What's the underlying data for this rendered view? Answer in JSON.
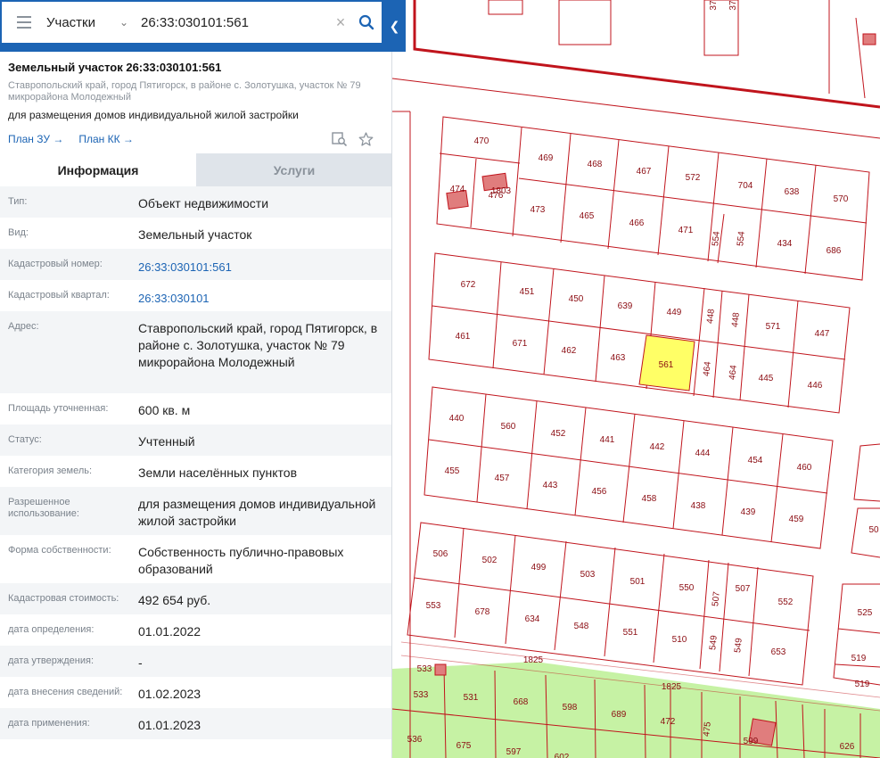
{
  "search": {
    "category": "Участки",
    "query": "26:33:030101:561"
  },
  "card": {
    "title": "Земельный участок 26:33:030101:561",
    "address": "Ставропольский край, город Пятигорск, в районе с. Золотушка, участок № 79 микрорайона Молодежный",
    "purpose": "для размещения домов индивидуальной жилой застройки",
    "link_plan_zu": "План ЗУ →",
    "link_plan_kk": "План КК →"
  },
  "tabs": {
    "info": "Информация",
    "services": "Услуги"
  },
  "info": {
    "rows": [
      {
        "label": "Тип:",
        "value": "Объект недвижимости"
      },
      {
        "label": "Вид:",
        "value": "Земельный участок"
      },
      {
        "label": "Кадастровый номер:",
        "value": "26:33:030101:561"
      },
      {
        "label": "Кадастровый квартал:",
        "value": "26:33:030101"
      },
      {
        "label": "Адрес:",
        "value": "Ставропольский край, город Пятигорск, в районе с. Золотушка, участок № 79 микрорайона Молодежный"
      },
      {
        "label": "Площадь уточненная:",
        "value": "600 кв. м"
      },
      {
        "label": "Статус:",
        "value": "Учтенный"
      },
      {
        "label": "Категория земель:",
        "value": "Земли населённых пунктов"
      },
      {
        "label": "Разрешенное использование:",
        "value": "для размещения домов индивидуальной жилой застройки"
      },
      {
        "label": "Форма собственности:",
        "value": "Собственность публично-правовых образований"
      },
      {
        "label": "Кадастровая стоимость:",
        "value": "492 654 руб."
      },
      {
        "label": "дата определения:",
        "value": "01.01.2022"
      },
      {
        "label": "дата утверждения:",
        "value": "-"
      },
      {
        "label": "дата внесения сведений:",
        "value": "01.02.2023"
      },
      {
        "label": "дата применения:",
        "value": "01.01.2023"
      }
    ]
  },
  "map": {
    "selected_parcel": "561",
    "colors": {
      "boundary": "#c0141c",
      "selected": "#ffff66",
      "green_zone": "#c6f2a4",
      "building": "#e07d7d",
      "accent": "#1c64b4"
    },
    "parcel_labels": [
      "37",
      "37",
      "470",
      "469",
      "468",
      "467",
      "572",
      "704",
      "638",
      "570",
      "474",
      "1803",
      "476",
      "473",
      "465",
      "466",
      "471",
      "554",
      "554",
      "434",
      "686",
      "672",
      "451",
      "450",
      "639",
      "449",
      "448",
      "448",
      "571",
      "447",
      "461",
      "671",
      "462",
      "463",
      "561",
      "464",
      "464",
      "445",
      "446",
      "440",
      "560",
      "452",
      "441",
      "442",
      "444",
      "454",
      "460",
      "455",
      "457",
      "443",
      "456",
      "458",
      "438",
      "439",
      "459",
      "506",
      "502",
      "499",
      "503",
      "501",
      "550",
      "507",
      "552",
      "553",
      "678",
      "634",
      "548",
      "551",
      "510",
      "549",
      "549",
      "653",
      "525",
      "519",
      "519",
      "50",
      "1825",
      "1825",
      "533",
      "533",
      "531",
      "668",
      "598",
      "689",
      "472",
      "475",
      "599",
      "626",
      "536",
      "675",
      "597",
      "602"
    ]
  }
}
